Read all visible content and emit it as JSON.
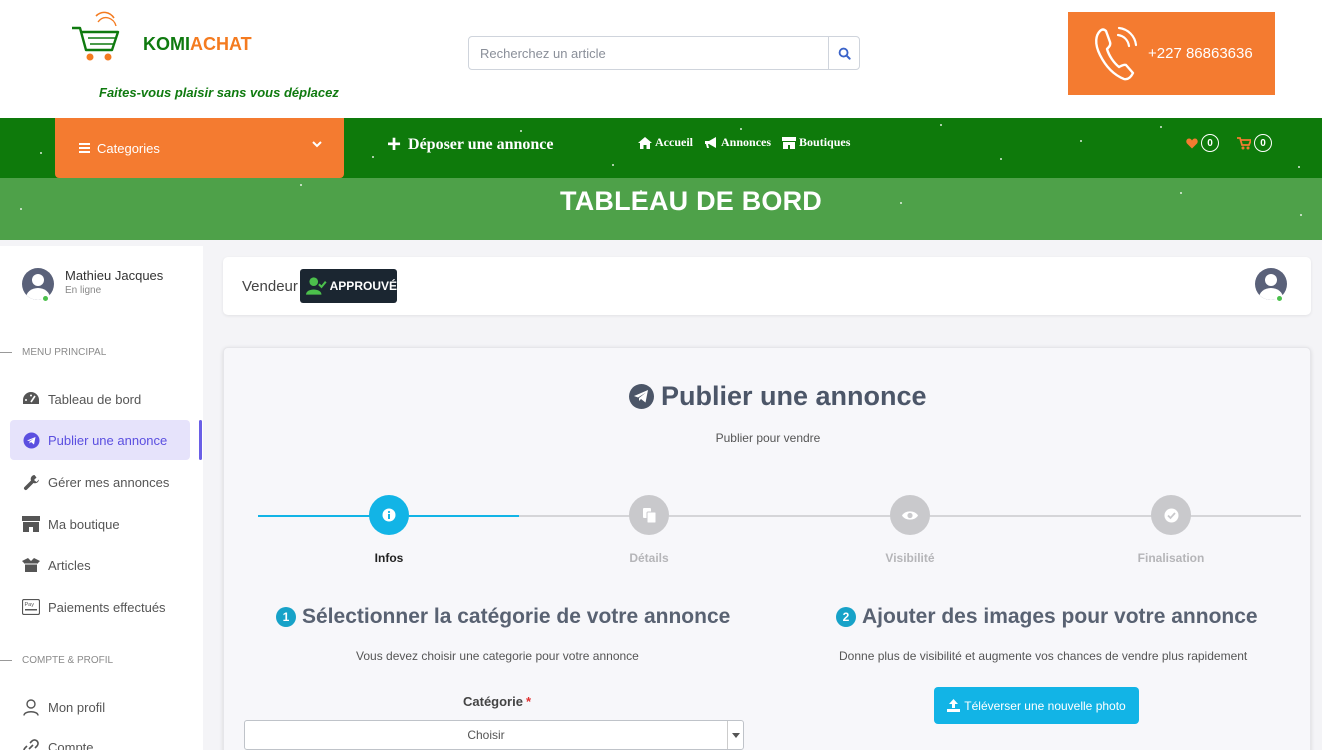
{
  "header": {
    "brand_part1": "KOMI",
    "brand_part2": "ACHAT",
    "slogan": "Faites-vous plaisir sans vous déplacez",
    "search_placeholder": "Recherchez un article",
    "phone": "+227 86863636"
  },
  "nav": {
    "categories_label": "Categories",
    "deposer_label": "Déposer une annonce",
    "links": [
      {
        "label": "Accueil",
        "icon": "home-icon"
      },
      {
        "label": "Annonces",
        "icon": "megaphone-icon"
      },
      {
        "label": "Boutiques",
        "icon": "store-icon"
      }
    ],
    "wishlist_count": "0",
    "cart_count": "0"
  },
  "banner": {
    "title": "TABLEAU DE BORD"
  },
  "sidebar": {
    "user_name": "Mathieu Jacques",
    "user_status": "En ligne",
    "section_main": "MENU PRINCIPAL",
    "main_items": [
      {
        "label": "Tableau de bord",
        "icon": "dashboard-icon"
      },
      {
        "label": "Publier une annonce",
        "icon": "telegram-icon",
        "active": true
      },
      {
        "label": "Gérer mes annonces",
        "icon": "wrench-icon"
      },
      {
        "label": "Ma boutique",
        "icon": "store-icon"
      },
      {
        "label": "Articles",
        "icon": "box-icon"
      },
      {
        "label": "Paiements effectués",
        "icon": "pay-icon"
      }
    ],
    "section_account": "COMPTE & PROFIL",
    "account_items": [
      {
        "label": "Mon profil",
        "icon": "user-icon"
      },
      {
        "label": "Compte",
        "icon": "link-icon"
      }
    ]
  },
  "vendeur": {
    "label": "Vendeur",
    "badge": "APPROUVÉ"
  },
  "publish": {
    "title": "Publier une annonce",
    "subtitle": "Publier pour vendre",
    "steps": [
      {
        "label": "Infos",
        "icon": "info-icon",
        "active": true
      },
      {
        "label": "Détails",
        "icon": "documents-icon",
        "active": false
      },
      {
        "label": "Visibilité",
        "icon": "eye-icon",
        "active": false
      },
      {
        "label": "Finalisation",
        "icon": "check-icon",
        "active": false
      }
    ],
    "section1": {
      "number": "1",
      "title": "Sélectionner la catégorie de votre annonce",
      "desc": "Vous devez choisir une categorie pour votre annonce",
      "field_label": "Catégorie",
      "required_mark": "*",
      "select_value": "Choisir"
    },
    "section2": {
      "number": "2",
      "title": "Ajouter des images pour votre annonce",
      "desc": "Donne plus de visibilité et augmente vos chances de vendre plus rapidement",
      "button_label": "Téléverser une nouvelle photo"
    }
  },
  "colors": {
    "green_dark": "#0e7a0b",
    "green_light": "#4ea149",
    "orange": "#f47b30",
    "cyan": "#12b4e6",
    "purple": "#6a5fe6"
  }
}
